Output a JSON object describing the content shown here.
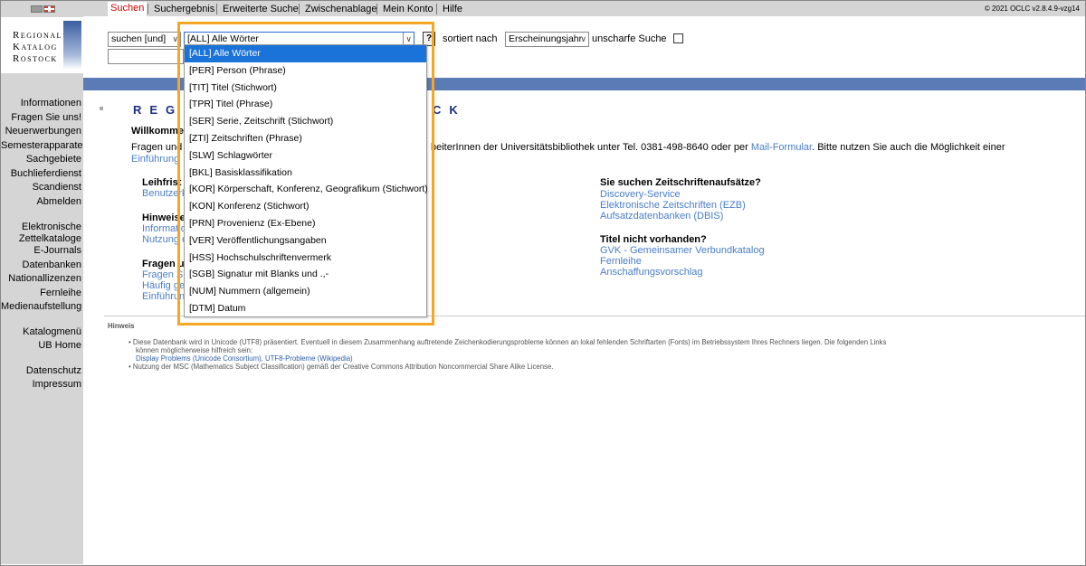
{
  "tabs": [
    "Suchen",
    "Suchergebnis",
    "Erweiterte Suche",
    "Zwischenablage",
    "Mein Konto",
    "Hilfe"
  ],
  "copyright": "© 2021 OCLC v2.8.4.9-vzg14",
  "logo": {
    "line1": "Regional",
    "line2": "Katalog",
    "line3": "Rostock"
  },
  "nav": {
    "group1": [
      "Informationen",
      "Fragen Sie uns!",
      "Neuerwerbungen",
      "Semesterapparate",
      "Sachgebiete",
      "Buchlieferdienst",
      "Scandienst",
      "Abmelden"
    ],
    "group2_line1": "Elektronische",
    "group2_line2": "Zettelkataloge",
    "group2": [
      "E-Journals",
      "Datenbanken",
      "Nationallizenzen",
      "Fernleihe",
      "Medienaufstellung"
    ],
    "group3": [
      "Katalogmenü",
      "UB Home"
    ],
    "group4": [
      "Datenschutz",
      "Impressum"
    ]
  },
  "search": {
    "operator": "suchen [und]",
    "field": "[ALL] Alle Wörter",
    "help_label": "?",
    "sort_label": "sortiert nach",
    "sort_value": "Erscheinungsjahr",
    "fuzzy_label": "unscharfe Suche",
    "query_value": ""
  },
  "dropdown_options": [
    "[ALL] Alle Wörter",
    "[PER] Person (Phrase)",
    "[TIT] Titel (Stichwort)",
    "[TPR] Titel (Phrase)",
    "[SER] Serie, Zeitschrift (Stichwort)",
    "[ZTI] Zeitschriften (Phrase)",
    "[SLW] Schlagwörter",
    "[BKL] Basisklassifikation",
    "[KOR] Körperschaft, Konferenz, Geografikum (Stichwort)",
    "[KON] Konferenz (Stichwort)",
    "[PRN] Provenienz (Ex-Ebene)",
    "[VER] Veröffentlichungsangaben",
    "[HSS] Hochschulschriftenvermerk",
    "[SGB] Signatur mit Blanks und .,-",
    "[NUM] Nummern (allgemein)",
    "[DTM] Datum"
  ],
  "content": {
    "banner_left": "REGI",
    "banner_right": "CK",
    "welcome": "Willkomme",
    "fragen_left": "Fragen und",
    "fragen_right": "beiterInnen der Universitätsbibliothek unter Tel. 0381-498-8640 oder per",
    "mail_link": "Mail-Formular",
    "fragen_end": ". Bitte nutzen Sie auch die Möglichkeit einer",
    "einfuehrung": "Einführung",
    "leihfrist": "Leihfrist",
    "benutzer": "Benutzerk",
    "hinweise": "Hinweise",
    "informa": "Informatio",
    "nutzung": "Nutzung e",
    "fragen_u": "Fragen u",
    "fragen_s": "Fragen S",
    "haeufig": "Häufig ge",
    "einfuehrung2": "Einführun",
    "zeitschriften_heading": "Sie suchen Zeitschriftenaufsätze?",
    "zeitschriften_links": [
      "Discovery-Service",
      "Elektronische Zeitschriften (EZB)",
      "Aufsatzdatenbanken (DBIS)"
    ],
    "titel_heading": "Titel nicht vorhanden?",
    "titel_links": [
      "GVK - Gemeinsamer Verbundkatalog",
      "Fernleihe",
      "Anschaffungsvorschlag"
    ],
    "hinweis_label": "Hinweis",
    "note1_line1": "Diese Datenbank wird in Unicode (UTF8) präsentiert. Eventuell in diesem Zusammenhang auftretende Zeichenkodierungsprobleme können an lokal fehlenden Schriftarten (Fonts) im Betriebssystem Ihres Rechners liegen. Die folgenden Links",
    "note1_line2": "können möglicherweise hilfreich sein:",
    "note1_link1": "Display Problems (Unicode Consortium)",
    "note1_sep": ",",
    "note1_link2": "UTF8-Probleme (Wikipedia)",
    "note2": "Nutzung der MSC (Mathematics Subject Classification) gemäß der Creative Commons Attribution Noncommercial Share Alike License."
  }
}
